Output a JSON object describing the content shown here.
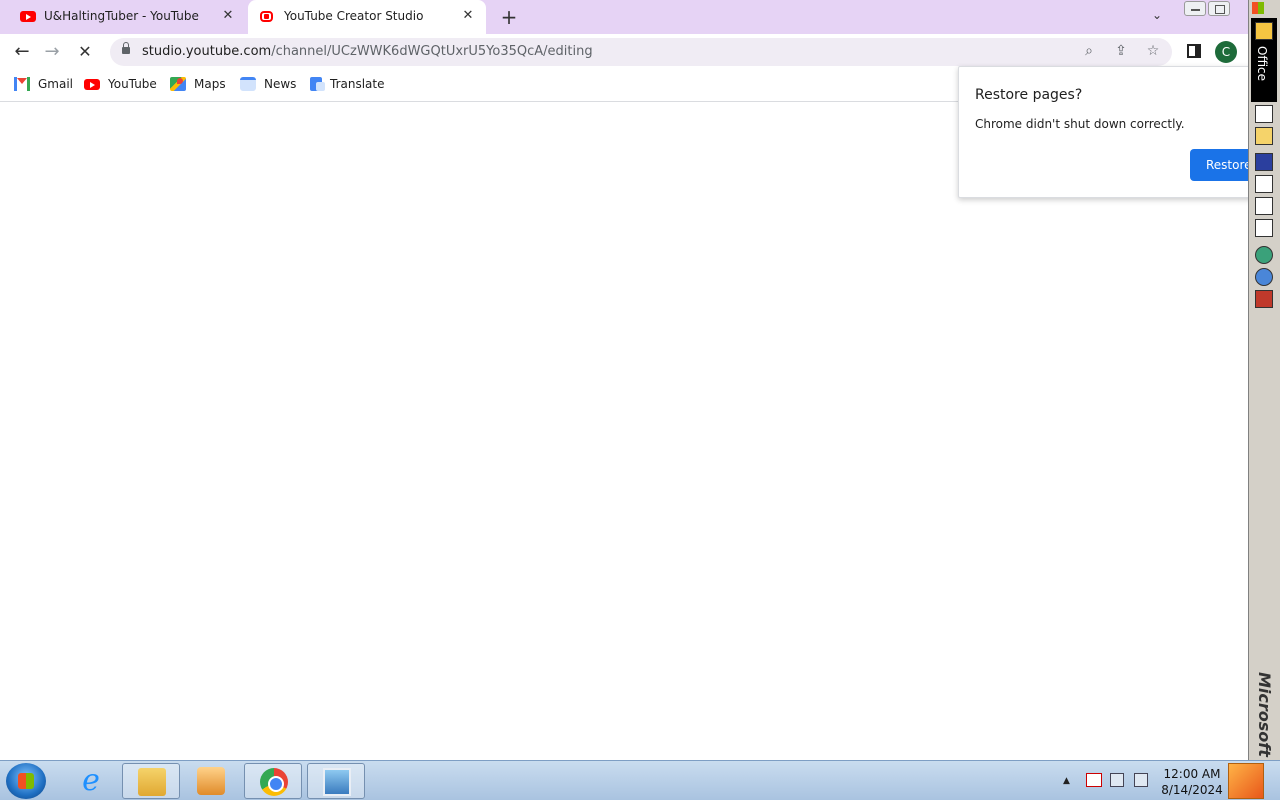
{
  "tabs": [
    {
      "title": "U&HaltingTuber - YouTube",
      "close": "✕"
    },
    {
      "title": "YouTube Creator Studio",
      "close": "✕"
    }
  ],
  "new_tab": "+",
  "tab_search": "⌄",
  "toolbar": {
    "back": "←",
    "forward": "→",
    "reload": "✕",
    "url_host": "studio.youtube.com",
    "url_path": "/channel/UCzWWK6dWGQtUxrU5Yo35QcA/editing",
    "zoom_icon": "⌕",
    "share_icon": "⇪",
    "star_icon": "☆",
    "avatar": "C"
  },
  "bookmarks": [
    {
      "label": "Gmail",
      "icon": "gmail-icon"
    },
    {
      "label": "YouTube",
      "icon": "youtube-icon"
    },
    {
      "label": "Maps",
      "icon": "maps-icon"
    },
    {
      "label": "News",
      "icon": "news-icon"
    },
    {
      "label": "Translate",
      "icon": "translate-icon"
    }
  ],
  "restore_popup": {
    "title": "Restore pages?",
    "message": "Chrome didn't shut down correctly.",
    "button": "Restore"
  },
  "office_bar": {
    "label": "Office",
    "brand": "Microsoft"
  },
  "taskbar": {
    "tray_up": "▲",
    "time": "12:00 AM",
    "date": "8/14/2024"
  },
  "colors": {
    "tabstrip": "#e6d3f5",
    "accent": "#1a73e8",
    "taskbar": "#b7cde6"
  }
}
